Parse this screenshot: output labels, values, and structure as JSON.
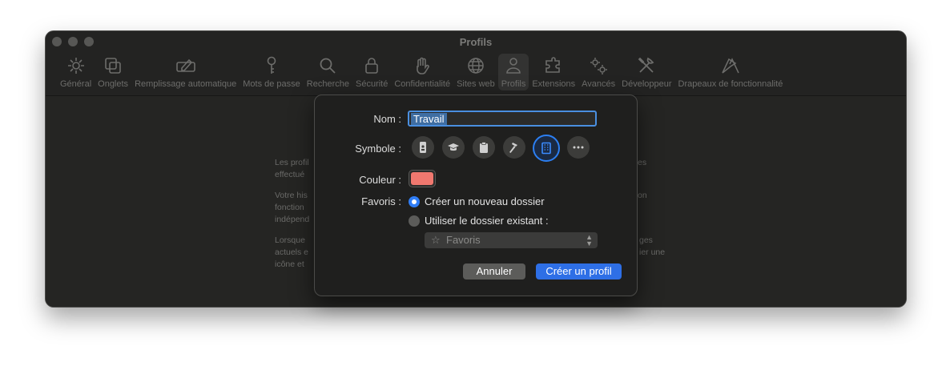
{
  "window": {
    "title": "Profils",
    "toolbar": [
      {
        "label": "Général",
        "icon": "gear-icon"
      },
      {
        "label": "Onglets",
        "icon": "tabs-icon"
      },
      {
        "label": "Remplissage automatique",
        "icon": "autofill-icon"
      },
      {
        "label": "Mots de passe",
        "icon": "key-icon"
      },
      {
        "label": "Recherche",
        "icon": "magnifier-icon"
      },
      {
        "label": "Sécurité",
        "icon": "lock-icon"
      },
      {
        "label": "Confidentialité",
        "icon": "hand-icon"
      },
      {
        "label": "Sites web",
        "icon": "globe-icon"
      },
      {
        "label": "Profils",
        "icon": "person-icon",
        "active": true
      },
      {
        "label": "Extensions",
        "icon": "puzzle-icon"
      },
      {
        "label": "Avancés",
        "icon": "gears-icon"
      },
      {
        "label": "Développeur",
        "icon": "tools-icon"
      },
      {
        "label": "Drapeaux de fonctionnalité",
        "icon": "flags-icon"
      }
    ]
  },
  "background_text": {
    "p1": [
      "Les profil",
      "effectué"
    ],
    "p1_right": [
      "es"
    ],
    "p2": [
      "Votre his",
      "fonction",
      "indépend"
    ],
    "p2_right": [
      "on"
    ],
    "p3": [
      "Lorsque",
      "actuels e",
      "icône et"
    ],
    "p3_right": [
      "ges",
      "ier une"
    ]
  },
  "dialog": {
    "name_label": "Nom :",
    "name_value": "Travail",
    "symbol_label": "Symbole :",
    "symbols": [
      {
        "icon": "badge-icon",
        "selected": false
      },
      {
        "icon": "graduation-cap-icon",
        "selected": false
      },
      {
        "icon": "clipboard-icon",
        "selected": false
      },
      {
        "icon": "hammer-icon",
        "selected": false
      },
      {
        "icon": "building-icon",
        "selected": true
      },
      {
        "icon": "more-icon",
        "selected": false
      }
    ],
    "color_label": "Couleur :",
    "color_value": "#f0786f",
    "favorites_label": "Favoris :",
    "option_new": "Créer un nouveau dossier",
    "option_existing": "Utiliser le dossier existant :",
    "folder_select": "Favoris",
    "cancel_label": "Annuler",
    "create_label": "Créer un profil"
  },
  "colors": {
    "accent": "#2e6fe6",
    "window_bg": "#262624",
    "dialog_bg": "#1f1f1e"
  }
}
